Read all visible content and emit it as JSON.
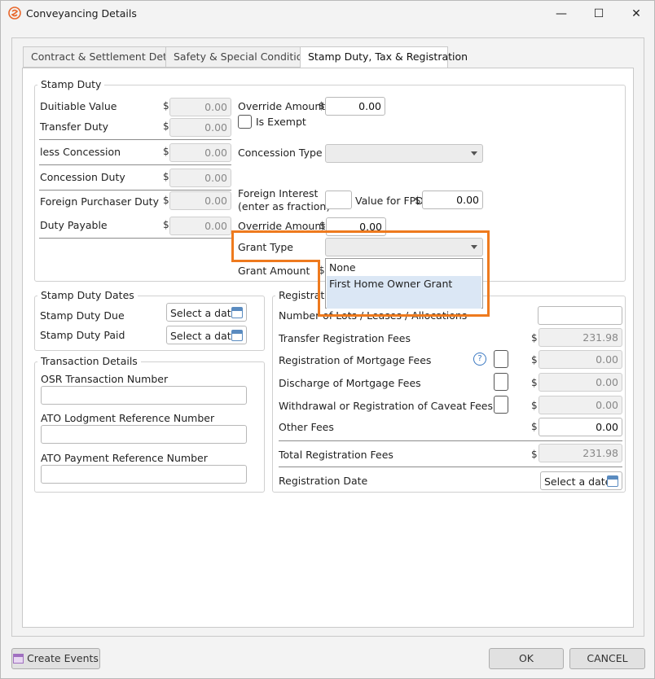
{
  "window": {
    "title": "Conveyancing Details",
    "minimize": "—",
    "maximize": "☐",
    "close": "✕"
  },
  "tabs": [
    {
      "label": "Contract & Settlement Details"
    },
    {
      "label": "Safety & Special Conditions"
    },
    {
      "label": "Stamp Duty, Tax & Registration"
    }
  ],
  "stamp_duty": {
    "legend": "Stamp Duty",
    "currency": "$",
    "dutiable_value": {
      "label": "Duitiable Value",
      "value": "0.00"
    },
    "transfer_duty": {
      "label": "Transfer Duty",
      "value": "0.00"
    },
    "less_concession": {
      "label": "less Concession",
      "value": "0.00"
    },
    "concession_duty": {
      "label": "Concession Duty",
      "value": "0.00"
    },
    "foreign_purchaser_duty": {
      "label": "Foreign Purchaser Duty",
      "value": "0.00"
    },
    "duty_payable": {
      "label": "Duty Payable",
      "value": "0.00"
    },
    "override_amount_1": {
      "label": "Override Amount",
      "value": "0.00"
    },
    "is_exempt": {
      "label": "Is Exempt"
    },
    "concession_type": {
      "label": "Concession Type",
      "value": ""
    },
    "foreign_interest": {
      "label_line1": "Foreign Interest",
      "label_line2": "(enter as fraction)",
      "value": ""
    },
    "value_for_fpd": {
      "label": "Value for FPD",
      "value": "0.00"
    },
    "override_amount_2": {
      "label": "Override Amount",
      "value": "0.00"
    },
    "grant_type": {
      "label": "Grant Type",
      "value": ""
    },
    "grant_amount": {
      "label": "Grant Amount"
    },
    "grant_options": [
      "None",
      "First Home Owner Grant"
    ]
  },
  "stamp_duty_dates": {
    "legend": "Stamp Duty Dates",
    "due_label": "Stamp Duty Due",
    "paid_label": "Stamp Duty Paid",
    "date_placeholder": "Select a date"
  },
  "transaction_details": {
    "legend": "Transaction Details",
    "osr_label": "OSR Transaction Number",
    "ato_lodgment_label": "ATO Lodgment Reference Number",
    "ato_payment_label": "ATO Payment Reference Number"
  },
  "registration": {
    "legend": "Registration",
    "lots_label": "Number of Lots / Leases / Allocations",
    "transfer_fees": {
      "label": "Transfer Registration Fees",
      "value": "231.98"
    },
    "mortgage_fees": {
      "label": "Registration of Mortgage Fees",
      "value": "0.00"
    },
    "discharge_fees": {
      "label": "Discharge of Mortgage Fees",
      "value": "0.00"
    },
    "caveat_fees": {
      "label": "Withdrawal or Registration of Caveat Fees",
      "value": "0.00"
    },
    "other_fees": {
      "label": "Other Fees",
      "value": "0.00"
    },
    "total_fees": {
      "label": "Total Registration Fees",
      "value": "231.98"
    },
    "registration_date": {
      "label": "Registration Date",
      "placeholder": "Select a date"
    },
    "help_glyph": "?"
  },
  "footer": {
    "create_events": "Create Events",
    "ok": "OK",
    "cancel": "CANCEL"
  },
  "colors": {
    "highlight": "#ee7a1e",
    "brand_icon": "#e8662a",
    "selected_item": "#dbe7f5"
  }
}
